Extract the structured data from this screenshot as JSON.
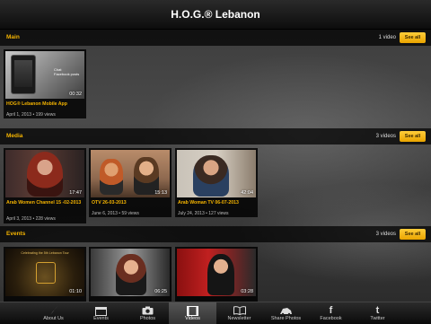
{
  "header": {
    "title": "H.O.G.® Lebanon"
  },
  "sections": [
    {
      "title": "Main",
      "count": "1 video",
      "see_all": "See all",
      "videos": [
        {
          "title": "HOG® Lebanon Mobile App",
          "meta": "April 1, 2013 • 199 views",
          "duration": "00:32",
          "thumb_text": "Chat\nFacebook posts"
        }
      ]
    },
    {
      "title": "Media",
      "count": "3 videos",
      "see_all": "See all",
      "videos": [
        {
          "title": "Arab Women Channel 15 -02-2013",
          "meta": "April 3, 2013 • 228 views",
          "duration": "17:47"
        },
        {
          "title": "OTV 26-03-2013",
          "meta": "June 6, 2013 • 59 views",
          "duration": "15:13"
        },
        {
          "title": "Arab Woman TV   06-07-2013",
          "meta": "July 24, 2013 • 127 views",
          "duration": "42:04"
        }
      ]
    },
    {
      "title": "Events",
      "count": "3 videos",
      "see_all": "See all",
      "videos": [
        {
          "title": "",
          "meta": "",
          "duration": "01:10",
          "thumb_text": "Celebrating the 5th Lebanon Tour"
        },
        {
          "title": "",
          "meta": "",
          "duration": "06:25"
        },
        {
          "title": "",
          "meta": "",
          "duration": "03:28"
        }
      ]
    }
  ],
  "tabs": [
    {
      "label": "About Us",
      "icon": "feather-icon"
    },
    {
      "label": "Events",
      "icon": "calendar-icon"
    },
    {
      "label": "Photos",
      "icon": "camera-icon"
    },
    {
      "label": "Videos",
      "icon": "video-icon",
      "active": true
    },
    {
      "label": "Newsletter",
      "icon": "book-icon"
    },
    {
      "label": "Share Photos",
      "icon": "share-photos-icon"
    },
    {
      "label": "Facebook",
      "icon": "facebook-icon"
    },
    {
      "label": "Twitter",
      "icon": "twitter-icon"
    }
  ],
  "colors": {
    "accent": "#f5b400",
    "button": "#f0b000",
    "bar": "#111111"
  }
}
